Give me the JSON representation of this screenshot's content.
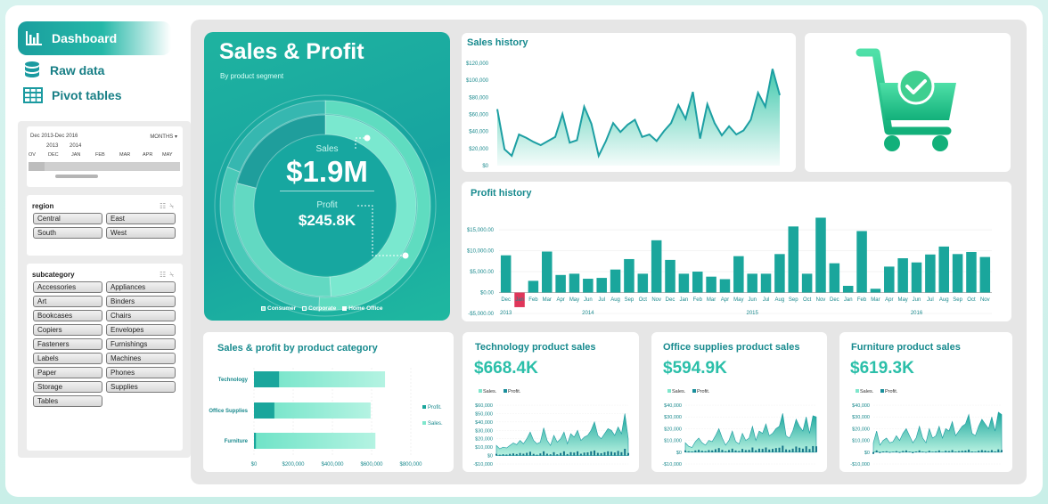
{
  "nav": {
    "dashboard": "Dashboard",
    "raw_data": "Raw data",
    "pivot_tables": "Pivot tables"
  },
  "timeline": {
    "range": "Dec 2013-Dec 2016",
    "unit": "MONTHS",
    "years": [
      "2013",
      "2014"
    ],
    "months": [
      "OV",
      "DEC",
      "JAN",
      "FEB",
      "MAR",
      "APR",
      "MAY"
    ]
  },
  "region": {
    "title": "region",
    "items": [
      "Central",
      "East",
      "South",
      "West"
    ]
  },
  "subcategory": {
    "title": "subcategory",
    "items": [
      "Accessories",
      "Appliances",
      "Art",
      "Binders",
      "Bookcases",
      "Chairs",
      "Copiers",
      "Envelopes",
      "Fasteners",
      "Furnishings",
      "Labels",
      "Machines",
      "Paper",
      "Phones",
      "Storage",
      "Supplies",
      "Tables"
    ]
  },
  "hero": {
    "title": "Sales & Profit",
    "subtitle": "By product segment",
    "sales_label": "Sales",
    "sales_value": "$1.9M",
    "profit_label": "Profit",
    "profit_value": "$245.8K",
    "legend": [
      "Consumer",
      "Corporate",
      "Home Office"
    ],
    "outer_ring_share": [
      0.51,
      0.3,
      0.19
    ],
    "inner_ring_share": [
      0.49,
      0.3,
      0.21
    ]
  },
  "sales_history": {
    "title": "Sales history",
    "y_ticks": [
      "$120,000",
      "$100,000",
      "$80,000",
      "$60,000",
      "$40,000",
      "$20,000",
      "$0"
    ],
    "ylim": [
      0,
      125000
    ],
    "values": [
      69000,
      20000,
      12000,
      38000,
      34000,
      29000,
      25000,
      30000,
      35000,
      63000,
      28000,
      31000,
      72000,
      51000,
      12000,
      30000,
      52000,
      41000,
      50000,
      56000,
      35000,
      38000,
      30000,
      42000,
      52000,
      74000,
      57000,
      90000,
      33000,
      75000,
      52000,
      37000,
      48000,
      38000,
      43000,
      56000,
      89000,
      72000,
      118000,
      86000
    ]
  },
  "profit_history": {
    "title": "Profit history",
    "y_ticks": [
      "$15,000.00",
      "$10,000.00",
      "$5,000.00",
      "$0.00",
      "-$5,000.00"
    ],
    "ylim": [
      -5000,
      18000
    ],
    "months": [
      "Dec",
      "Jan",
      "Feb",
      "Mar",
      "Apr",
      "May",
      "Jun",
      "Jul",
      "Aug",
      "Sep",
      "Oct",
      "Nov",
      "Dec",
      "Jan",
      "Feb",
      "Mar",
      "Apr",
      "May",
      "Jun",
      "Jul",
      "Aug",
      "Sep",
      "Oct",
      "Nov",
      "Dec",
      "Jan",
      "Feb",
      "Mar",
      "Apr",
      "May",
      "Jun",
      "Jul",
      "Aug",
      "Sep",
      "Oct",
      "Nov",
      "Dec"
    ],
    "years": [
      "2013",
      "2014",
      "2015",
      "2016"
    ],
    "values": [
      8900,
      -3500,
      2800,
      9800,
      4200,
      4500,
      3300,
      3500,
      5500,
      8000,
      4500,
      12500,
      7800,
      4500,
      5000,
      3800,
      3200,
      8700,
      4500,
      4500,
      9200,
      15800,
      4500,
      17900,
      7000,
      1600,
      14700,
      900,
      6200,
      8200,
      7200,
      9100,
      11000,
      9200,
      9700,
      8500
    ],
    "negative_color": "#e0365a",
    "bar_color": "#1aa69c"
  },
  "category_chart": {
    "title": "Sales & profit by product category",
    "categories": [
      "Technology",
      "Office Supplies",
      "Furniture"
    ],
    "sales": [
      668400,
      594900,
      619300
    ],
    "profit": [
      128000,
      104000,
      10000
    ],
    "x_ticks": [
      "$0",
      "$200,000",
      "$400,000",
      "$600,000",
      "$800,000"
    ],
    "legend": [
      "Profit.",
      "Sales."
    ]
  },
  "mini_charts": [
    {
      "title": "Technology product sales",
      "total": "$668.4K",
      "legend": [
        "Sales.",
        "Profit."
      ],
      "y_ticks": [
        "$60,000",
        "$50,000",
        "$40,000",
        "$30,000",
        "$20,000",
        "$10,000",
        "$0",
        "-$10,000"
      ],
      "ylim": [
        -10000,
        60000
      ],
      "values": [
        12000,
        8000,
        10000,
        9000,
        12000,
        15000,
        13000,
        18000,
        14000,
        20000,
        28000,
        18000,
        14000,
        16000,
        33000,
        18000,
        12000,
        24000,
        16000,
        20000,
        28000,
        14000,
        26000,
        22000,
        30000,
        18000,
        22000,
        24000,
        30000,
        40000,
        24000,
        20000,
        26000,
        32000,
        30000,
        24000,
        34000,
        26000,
        50000,
        20000
      ],
      "profit": [
        2000,
        1000,
        1500,
        1200,
        2000,
        2500,
        1800,
        3000,
        2200,
        3200,
        4500,
        2000,
        1000,
        2500,
        5000,
        2200,
        1500,
        4000,
        1500,
        3000,
        5000,
        1800,
        4000,
        3500,
        5000,
        2200,
        3500,
        3800,
        5000,
        6000,
        3200,
        2800,
        4000,
        5000,
        4500,
        3600,
        5500,
        4000,
        8000,
        3000
      ]
    },
    {
      "title": "Office supplies product sales",
      "total": "$594.9K",
      "legend": [
        "Sales.",
        "Profit."
      ],
      "y_ticks": [
        "$40,000",
        "$30,000",
        "$20,000",
        "$10,000",
        "$0",
        "-$10,000"
      ],
      "ylim": [
        -10000,
        40000
      ],
      "values": [
        8000,
        5000,
        4000,
        9000,
        12000,
        8000,
        6000,
        10000,
        9000,
        14000,
        20000,
        12000,
        6000,
        10000,
        18000,
        9000,
        7000,
        16000,
        10000,
        12000,
        22000,
        10000,
        18000,
        16000,
        24000,
        14000,
        16000,
        20000,
        22000,
        33000,
        14000,
        12000,
        18000,
        28000,
        22000,
        18000,
        30000,
        16000,
        31000,
        30000
      ],
      "profit": [
        1500,
        800,
        600,
        1500,
        2000,
        1200,
        900,
        1800,
        1500,
        2500,
        3500,
        2000,
        900,
        1800,
        3000,
        1500,
        1000,
        2800,
        1800,
        2000,
        4000,
        1700,
        3000,
        2800,
        4000,
        2300,
        2800,
        3500,
        3800,
        5500,
        2400,
        2000,
        3000,
        4800,
        3800,
        3000,
        5000,
        2700,
        5200,
        5000
      ]
    },
    {
      "title": "Furniture product sales",
      "total": "$619.3K",
      "legend": [
        "Sales.",
        "Profit."
      ],
      "y_ticks": [
        "$40,000",
        "$30,000",
        "$20,000",
        "$10,000",
        "$0",
        "-$10,000"
      ],
      "ylim": [
        -10000,
        40000
      ],
      "values": [
        8000,
        18000,
        6000,
        10000,
        12000,
        8000,
        9000,
        14000,
        10000,
        16000,
        20000,
        14000,
        8000,
        12000,
        22000,
        12000,
        8000,
        20000,
        12000,
        14000,
        22000,
        12000,
        20000,
        18000,
        26000,
        14000,
        18000,
        22000,
        24000,
        32000,
        16000,
        14000,
        22000,
        28000,
        24000,
        20000,
        30000,
        18000,
        34000,
        32000
      ],
      "profit": [
        -1500,
        1500,
        -800,
        600,
        800,
        -500,
        400,
        900,
        -600,
        1000,
        1500,
        500,
        -900,
        600,
        1500,
        500,
        -400,
        1200,
        400,
        700,
        1500,
        300,
        1200,
        900,
        1800,
        500,
        900,
        1200,
        1400,
        2200,
        600,
        400,
        1200,
        1800,
        1400,
        900,
        1800,
        700,
        2400,
        1800
      ]
    }
  ],
  "colors": {
    "accent": "#1aa69c",
    "accent_light": "#5fdcc0",
    "title": "#178a8e",
    "kpi": "#2bbfa9"
  }
}
